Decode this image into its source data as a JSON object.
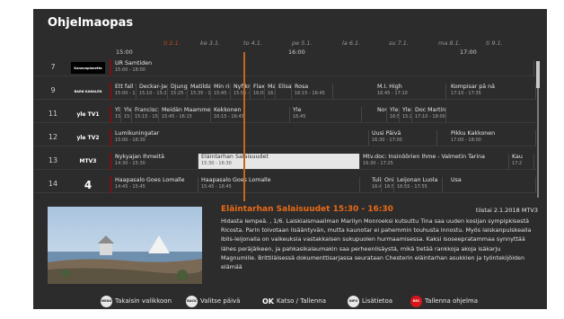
{
  "title": "Ohjelmaopas",
  "days": [
    {
      "label": "ti 2.1.",
      "active": true
    },
    {
      "label": "ke 3.1.",
      "active": false
    },
    {
      "label": "to 4.1.",
      "active": false
    },
    {
      "label": "pe 5.1.",
      "active": false
    },
    {
      "label": "la 6.1.",
      "active": false
    },
    {
      "label": "su 7.1.",
      "active": false
    },
    {
      "label": "ma 8.1.",
      "active": false
    },
    {
      "label": "ti 9.1.",
      "active": false
    }
  ],
  "timeline": [
    "15:00",
    "16:00",
    "17:00"
  ],
  "channels": [
    {
      "num": "7",
      "logo": "Kanavaplanetta",
      "logo_name": "kanavaplanetta-logo",
      "logo_color": "#ffffff",
      "logo_bg": "#000000",
      "programs": [
        {
          "title": "UR Samtiden",
          "time": "15:00 - 18:00"
        }
      ]
    },
    {
      "num": "9",
      "logo": "BARN KANALEN",
      "logo_name": "barnkanalen-logo",
      "logo_color": "#ffffff",
      "logo_bg": "transparent",
      "programs": [
        {
          "title": "Ett fall f",
          "time": "15:00 - 1!"
        },
        {
          "title": "Deckar-Jack",
          "time": "15:10 - 15:25"
        },
        {
          "title": "Djungel",
          "time": "15:25 - 1!"
        },
        {
          "title": "Matilda",
          "time": "15:35 - 1!"
        },
        {
          "title": "Min ridi",
          "time": "15:45 - 1!"
        },
        {
          "title": "Nyfikna",
          "time": "15:55 - 1!"
        },
        {
          "title": "Flax",
          "time": "16:05 - 1!"
        },
        {
          "title": "Ma",
          "time": "16:15 - 16:45"
        },
        {
          "title": "Elisabet",
          "time": ""
        },
        {
          "title": "Rosa",
          "time": "16:15 - 16:45"
        },
        {
          "title": "M.I. High",
          "time": "16:45 - 17:10"
        },
        {
          "title": "Kompisar på nä",
          "time": "17:10 - 17:35"
        }
      ]
    },
    {
      "num": "11",
      "logo": "yle TV1",
      "logo_name": "yle-tv1-logo",
      "logo_color": "#ffffff",
      "logo_bg": "transparent",
      "programs": [
        {
          "title": "Yle",
          "time": "15:00"
        },
        {
          "title": "Yle",
          "time": "15:10"
        },
        {
          "title": "Franciscus - Paavi, Joka Kosk",
          "time": "15:15 - 15:45"
        },
        {
          "title": "Meidän Maamme - Värt",
          "time": "15:45 - 16:15"
        },
        {
          "title": "Kekkonen",
          "time": "16:15 - 16:45"
        },
        {
          "title": "Yle",
          "time": "16:45"
        },
        {
          "title": "Nov",
          "time": ""
        },
        {
          "title": "Yle",
          "time": "16:55"
        },
        {
          "title": "Yle L",
          "time": "15:25"
        },
        {
          "title": "Doc Martin",
          "time": "17:10 - 18:00"
        }
      ]
    },
    {
      "num": "12",
      "logo": "yle TV2",
      "logo_name": "yle-tv2-logo",
      "logo_color": "#ffffff",
      "logo_bg": "transparent",
      "programs": [
        {
          "title": "Lumikuningatar",
          "time": "15:00 - 16:30"
        },
        {
          "title": "Uusi Päivä",
          "time": "16:30 - 17:00"
        },
        {
          "title": "Pikku Kakkonen",
          "time": "17:00 - 18:00"
        }
      ]
    },
    {
      "num": "13",
      "logo": "MTV3",
      "logo_name": "mtv3-logo",
      "logo_color": "#ffffff",
      "logo_bg": "transparent",
      "programs": [
        {
          "title": "Nykyajan Ihmeitä",
          "time": "14:30 - 15:30"
        },
        {
          "title": "Eläintarhan Salaisuudet",
          "time": "15:30 - 16:30",
          "selected": true
        },
        {
          "title": "Mtv.doc: Insinöörien Ihme - Valmetin Tarina",
          "time": "16:30 - 17:25"
        },
        {
          "title": "Kau",
          "time": "17:2"
        }
      ]
    },
    {
      "num": "14",
      "logo": "4",
      "logo_name": "nelonen-logo",
      "logo_color": "#ffffff",
      "logo_bg": "transparent",
      "programs": [
        {
          "title": "Haapasalo Goes Lomalle",
          "time": "14:45 - 15:45"
        },
        {
          "title": "Haapasalo Goes Lomalle",
          "time": "15:45 - 16:45"
        },
        {
          "title": "Tuli",
          "time": "16:4"
        },
        {
          "title": "Oni",
          "time": "16:55"
        },
        {
          "title": "Leijonan Luola",
          "time": "16:55 - 17:55"
        },
        {
          "title": "Usa",
          "time": ""
        }
      ]
    }
  ],
  "detail": {
    "title": "Eläintarhan Salaisuudet  15:30 - 16:30",
    "date_channel": "tiistai 2.1.2018 MTV3",
    "description": "Hidasta lempeä. , 1/6. Laiskiaismaailman Marilyn Monroeksi kutsuttu Tina saa uuden kosijan sympipkisestä Ricosta. Parin toivotaan lisääntyvän, mutta kaunotar ei pahemmin touhusta innostu. Myös laiskanpulskealla Iblis-leijonalla on vaikeuksia vastakkaisen sukupuolen hurmaamisessa. Kaksi isoseepratammaa synnyttää lähes peräjälkeen, ja pahkasikalaumakin saa perheenlisäystä, mikä tietää rankkoja akoja isäkarju Magnumille. Brittiläisessä dokumenttisarjassa seurataan Chesterin eläintarhan asukkien ja työntekijöiden elämää"
  },
  "footer": [
    {
      "key": "MENU",
      "label": "Takaisin valikkoon",
      "name": "menu"
    },
    {
      "key": "BACK",
      "label": "Valitse päivä",
      "name": "back"
    },
    {
      "key": "OK",
      "label": "Katso / Tallenna",
      "name": "ok"
    },
    {
      "key": "INFO",
      "label": "Lisätietoa",
      "name": "info"
    },
    {
      "key": "REC",
      "label": "Tallenna ohjelma",
      "name": "rec"
    }
  ],
  "colors": {
    "accent": "#e86a18",
    "rec": "#d8161a",
    "background": "#2c2c2c"
  }
}
